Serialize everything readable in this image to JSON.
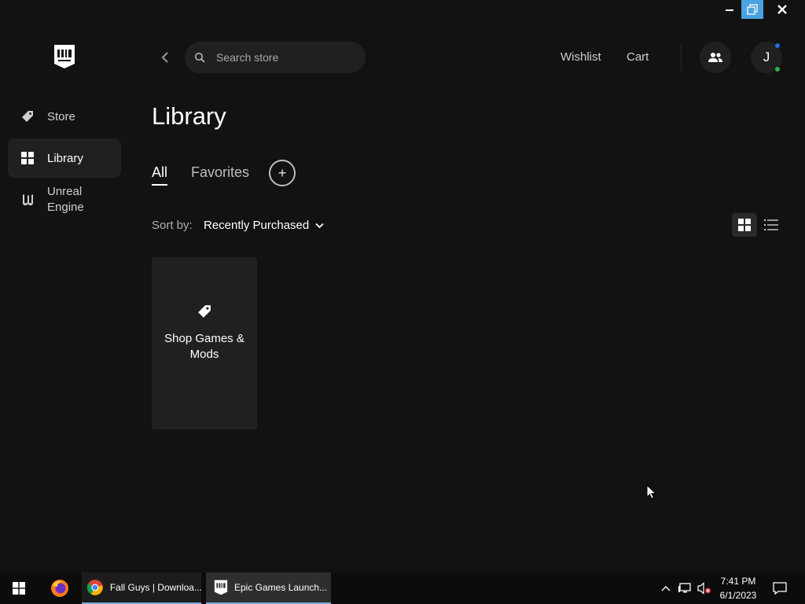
{
  "header": {
    "search_placeholder": "Search store",
    "wishlist_label": "Wishlist",
    "cart_label": "Cart",
    "avatar_initial": "J"
  },
  "sidebar": {
    "items": [
      {
        "label": "Store",
        "icon": "tag-icon"
      },
      {
        "label": "Library",
        "icon": "grid-icon",
        "active": true
      },
      {
        "label": "Unreal Engine",
        "icon": "unreal-engine-icon"
      }
    ]
  },
  "main": {
    "title": "Library",
    "tabs": [
      {
        "label": "All",
        "active": true
      },
      {
        "label": "Favorites"
      }
    ],
    "add_collection_symbol": "+",
    "sort_label": "Sort by:",
    "sort_value": "Recently Purchased",
    "cards": [
      {
        "label": "Shop Games & Mods",
        "icon": "tag-icon"
      }
    ]
  },
  "taskbar": {
    "apps": [
      {
        "label": "Fall Guys | Downloa...",
        "icon": "chrome-icon"
      },
      {
        "label": "Epic Games Launch...",
        "icon": "epic-games-icon"
      }
    ],
    "clock_time": "7:41 PM",
    "clock_date": "6/1/2023"
  },
  "colors": {
    "background": "#121212",
    "surface": "#202020",
    "accent_blue": "#2a6be0",
    "status_green": "#2bb14b"
  }
}
